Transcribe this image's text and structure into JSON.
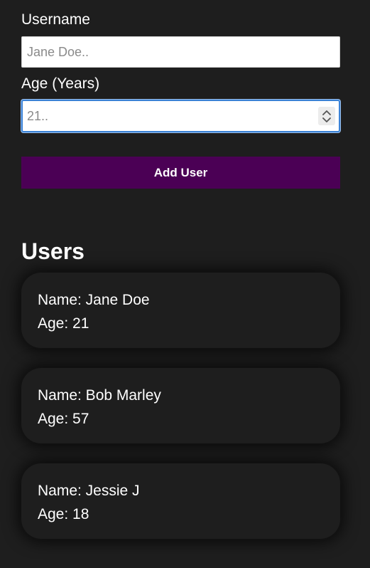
{
  "form": {
    "username": {
      "label": "Username",
      "placeholder": "Jane Doe..",
      "value": ""
    },
    "age": {
      "label": "Age (Years)",
      "placeholder": "21..",
      "value": ""
    },
    "submit_label": "Add User"
  },
  "users_section": {
    "heading": "Users",
    "users": [
      {
        "name_line": "Name: Jane Doe",
        "age_line": "Age: 21"
      },
      {
        "name_line": "Name: Bob Marley",
        "age_line": "Age: 57"
      },
      {
        "name_line": "Name: Jessie J",
        "age_line": "Age: 18"
      }
    ]
  },
  "icons": {
    "spinner_up": "chevron-up-icon",
    "spinner_down": "chevron-down-icon"
  },
  "colors": {
    "background": "#1e1e1e",
    "button": "#4b0055",
    "focus_ring": "#3b82d6",
    "text": "#ffffff"
  }
}
